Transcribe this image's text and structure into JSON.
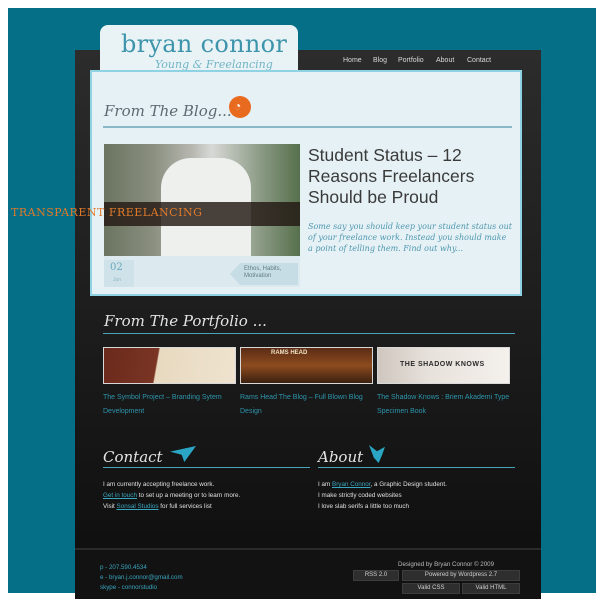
{
  "header": {
    "logo_name": "bryan connor",
    "logo_tagline": "Young & Freelancing",
    "nav": [
      "Home",
      "Blog",
      "Portfolio",
      "About",
      "Contact"
    ]
  },
  "blog": {
    "heading": "From The Blog...",
    "photo_banner": "TRANSPARENT FREELANCING",
    "date_day": "02",
    "date_month": "Jun",
    "post_tags": "Ethos, Habits, Motivation",
    "post_title": "Student Status – 12 Reasons Freelancers Should be Proud",
    "excerpt": "Some say you should keep your student status out of your freelance work. Instead you should make a point of telling them. Find out why..."
  },
  "portfolio": {
    "heading": "From The Portfolio ...",
    "items": [
      {
        "caption": "The Symbol Project – Branding Sytem Development"
      },
      {
        "caption": "Rams Head The Blog – Full Blown Blog Design",
        "thumb_text": "RAMS HEAD"
      },
      {
        "caption": "The Shadow Knows : Briem Akademi Type Specimen Book",
        "thumb_text": "THE SHADOW KNOWS"
      }
    ]
  },
  "contact": {
    "heading": "Contact",
    "line1": "I am currently accepting freelance work.",
    "line2_link": "Get in touch",
    "line2_rest": " to set up a meeting or to learn more.",
    "line3_pre": "Visit ",
    "line3_link": "Sonsal Studios",
    "line3_rest": " for full services list"
  },
  "about": {
    "heading": "About",
    "line1_pre": "I am ",
    "line1_link": "Bryan Connor",
    "line1_rest": ", a Graphic Design student.",
    "line2": "I make strictly coded websites",
    "line3": "I love slab serifs a little too much"
  },
  "footer": {
    "phone": "p - 207.590.4534",
    "email": "e - bryan.j.connor@gmail.com",
    "skype": "skype - connorstudio",
    "credit": "Designed by Bryan Connor © 2009",
    "badges": [
      "RSS 2.0",
      "Powered by Wordpress 2.7",
      "Valid CSS",
      "Valid HTML"
    ]
  },
  "colors": {
    "background": "#046f86",
    "accent": "#3aa6c0",
    "rss": "#e86a1f"
  }
}
